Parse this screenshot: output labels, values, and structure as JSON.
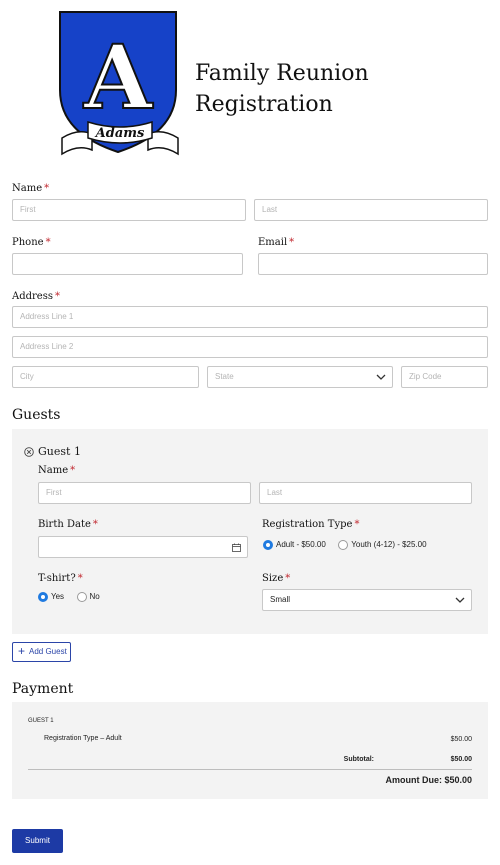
{
  "header": {
    "crest_initial": "A",
    "crest_banner": "Adams",
    "title_line1": "Family Reunion",
    "title_line2": "Registration"
  },
  "form": {
    "name": {
      "label": "Name",
      "first_placeholder": "First",
      "last_placeholder": "Last"
    },
    "phone": {
      "label": "Phone",
      "value": ""
    },
    "email": {
      "label": "Email",
      "value": ""
    },
    "address": {
      "label": "Address",
      "line1_placeholder": "Address Line 1",
      "line2_placeholder": "Address Line 2",
      "city_placeholder": "City",
      "state_placeholder": "State",
      "zip_placeholder": "Zip Code"
    },
    "required_mark": "*"
  },
  "guests": {
    "section_title": "Guests",
    "guest": {
      "title": "Guest 1",
      "name_label": "Name",
      "first_placeholder": "First",
      "last_placeholder": "Last",
      "birth_label": "Birth Date",
      "reg_type_label": "Registration Type",
      "reg_options": [
        "Adult - $50.00",
        "Youth (4-12) - $25.00"
      ],
      "reg_selected": "Adult - $50.00",
      "tshirt_label": "T-shirt?",
      "tshirt_options": [
        "Yes",
        "No"
      ],
      "tshirt_selected": "Yes",
      "size_label": "Size",
      "size_value": "Small"
    },
    "add_button": "Add Guest"
  },
  "payment": {
    "section_title": "Payment",
    "group_label": "GUEST 1",
    "line_item": "Registration Type – Adult",
    "line_amount": "$50.00",
    "subtotal_label": "Subtotal:",
    "subtotal_amount": "$50.00",
    "amount_due": "Amount Due: $50.00"
  },
  "submit_label": "Submit",
  "colors": {
    "accent": "#1d3aa5",
    "required": "#c0262d",
    "radio_on": "#1f7ae0",
    "panel": "#f3f3f3"
  }
}
